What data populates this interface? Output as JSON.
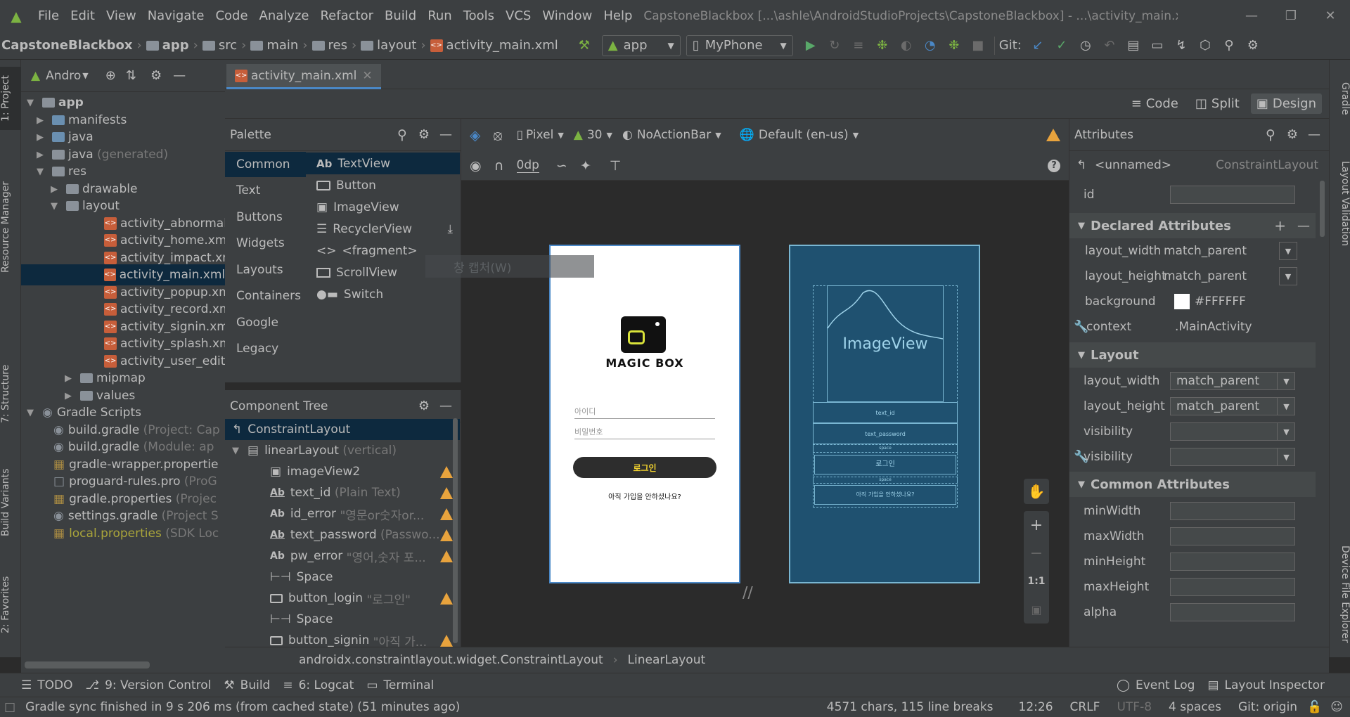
{
  "menu": {
    "items": [
      "File",
      "Edit",
      "View",
      "Navigate",
      "Code",
      "Analyze",
      "Refactor",
      "Build",
      "Run",
      "Tools",
      "VCS",
      "Window",
      "Help"
    ],
    "title": "CapstoneBlackbox [...\\ashle\\AndroidStudioProjects\\CapstoneBlackbox] - ...\\activity_main.xml [app]"
  },
  "nav": {
    "crumbs": [
      "CapstoneBlackbox",
      "app",
      "src",
      "main",
      "res",
      "layout",
      "activity_main.xml"
    ],
    "module": "app",
    "device": "MyPhone",
    "git_label": "Git:"
  },
  "left_tabs": [
    "1: Project",
    "Resource Manager",
    "7: Structure",
    "Build Variants",
    "2: Favorites"
  ],
  "right_tabs": [
    "Gradle",
    "Layout Validation",
    "Device File Explorer"
  ],
  "project": {
    "view": "Andro",
    "tree": [
      {
        "label": "app",
        "extra": "",
        "bold": true
      },
      {
        "label": "manifests",
        "extra": ""
      },
      {
        "label": "java",
        "extra": ""
      },
      {
        "label": "java",
        "extra": "(generated)"
      },
      {
        "label": "res",
        "extra": ""
      },
      {
        "label": "drawable",
        "extra": ""
      },
      {
        "label": "layout",
        "extra": ""
      },
      {
        "label": "activity_abnormal.",
        "extra": ""
      },
      {
        "label": "activity_home.xml",
        "extra": ""
      },
      {
        "label": "activity_impact.xm",
        "extra": ""
      },
      {
        "label": "activity_main.xml",
        "extra": ""
      },
      {
        "label": "activity_popup.xm",
        "extra": ""
      },
      {
        "label": "activity_record.xm",
        "extra": ""
      },
      {
        "label": "activity_signin.xml",
        "extra": ""
      },
      {
        "label": "activity_splash.xml",
        "extra": ""
      },
      {
        "label": "activity_user_edit.x",
        "extra": ""
      },
      {
        "label": "mipmap",
        "extra": ""
      },
      {
        "label": "values",
        "extra": ""
      },
      {
        "label": "Gradle Scripts",
        "extra": ""
      },
      {
        "label": "build.gradle",
        "extra": "(Project: Cap"
      },
      {
        "label": "build.gradle",
        "extra": "(Module: ap"
      },
      {
        "label": "gradle-wrapper.propertie",
        "extra": ""
      },
      {
        "label": "proguard-rules.pro",
        "extra": "(ProG"
      },
      {
        "label": "gradle.properties",
        "extra": "(Projec"
      },
      {
        "label": "settings.gradle",
        "extra": "(Project S"
      },
      {
        "label": "local.properties",
        "extra": "(SDK Loc"
      }
    ]
  },
  "editor": {
    "tab": "activity_main.xml",
    "modes": [
      "Code",
      "Split",
      "Design"
    ]
  },
  "palette": {
    "title": "Palette",
    "categories": [
      "Common",
      "Text",
      "Buttons",
      "Widgets",
      "Layouts",
      "Containers",
      "Google",
      "Legacy"
    ],
    "items": [
      "TextView",
      "Button",
      "ImageView",
      "RecyclerView",
      "<fragment>",
      "ScrollView",
      "Switch"
    ],
    "item_icons": [
      "Ab",
      "",
      "",
      "",
      "<>",
      "",
      ""
    ],
    "tooltip": "창 캡처(W)"
  },
  "component_tree": {
    "title": "Component Tree",
    "items": [
      {
        "icon": "",
        "label": "ConstraintLayout",
        "extra": ""
      },
      {
        "icon": "",
        "label": "linearLayout",
        "extra": "(vertical)"
      },
      {
        "icon": "",
        "label": "imageView2",
        "extra": ""
      },
      {
        "icon": "Ab",
        "label": "text_id",
        "extra": "(Plain Text)"
      },
      {
        "icon": "Ab",
        "label": "id_error",
        "extra": "\"영문or숫자or..."
      },
      {
        "icon": "Ab",
        "label": "text_password",
        "extra": "(Passwo..."
      },
      {
        "icon": "Ab",
        "label": "pw_error",
        "extra": "\"영어,숫자 포..."
      },
      {
        "icon": "",
        "label": "Space",
        "extra": ""
      },
      {
        "icon": "",
        "label": "button_login",
        "extra": "\"로그인\""
      },
      {
        "icon": "",
        "label": "Space",
        "extra": ""
      },
      {
        "icon": "",
        "label": "button_signin",
        "extra": "\"아직 가..."
      }
    ]
  },
  "design": {
    "device": "Pixel",
    "api": "30",
    "theme": "NoActionBar",
    "locale": "Default (en-us)",
    "margin": "0dp",
    "phone": {
      "logo": "MAGIC BOX",
      "hint_id": "아이디",
      "hint_pw": "비밀번호",
      "login": "로그인",
      "signup": "아직 가입을 안하셨나요?"
    },
    "blueprint": {
      "image": "ImageView",
      "text_id": "text_id",
      "text_password": "text_password",
      "space": "space",
      "login": "로그인",
      "space2": "space",
      "signup": "아직 가입을 안하셨나요?"
    },
    "zoom_fit": "1:1"
  },
  "attributes": {
    "title": "Attributes",
    "element": "<unnamed>",
    "type": "ConstraintLayout",
    "id_label": "id",
    "declared_title": "Declared Attributes",
    "declared": [
      {
        "name": "layout_width",
        "value": "match_parent"
      },
      {
        "name": "layout_height",
        "value": "match_parent"
      },
      {
        "name": "background",
        "value": "#FFFFFF"
      },
      {
        "name": "context",
        "value": ".MainActivity"
      }
    ],
    "layout_title": "Layout",
    "layout": [
      {
        "name": "layout_width",
        "value": "match_parent"
      },
      {
        "name": "layout_height",
        "value": "match_parent"
      },
      {
        "name": "visibility",
        "value": ""
      },
      {
        "name": "visibility",
        "value": ""
      }
    ],
    "common_title": "Common Attributes",
    "common": [
      {
        "name": "minWidth"
      },
      {
        "name": "maxWidth"
      },
      {
        "name": "minHeight"
      },
      {
        "name": "maxHeight"
      },
      {
        "name": "alpha"
      }
    ]
  },
  "breadcrumb": [
    "androidx.constraintlayout.widget.ConstraintLayout",
    "LinearLayout"
  ],
  "toolwindows": [
    "TODO",
    "9: Version Control",
    "Build",
    "6: Logcat",
    "Terminal"
  ],
  "toolwindows_right": [
    "Event Log",
    "Layout Inspector"
  ],
  "status": {
    "message": "Gradle sync finished in 9 s 206 ms (from cached state) (51 minutes ago)",
    "chars": "4571 chars, 115 line breaks",
    "pos": "12:26",
    "eol": "CRLF",
    "enc": "UTF-8",
    "indent": "4 spaces",
    "git": "Git: origin"
  },
  "colors": {
    "accent": "#4a88c7",
    "warning": "#e8a33d",
    "selection": "#0d293e",
    "blueprint": "#1f5170"
  }
}
